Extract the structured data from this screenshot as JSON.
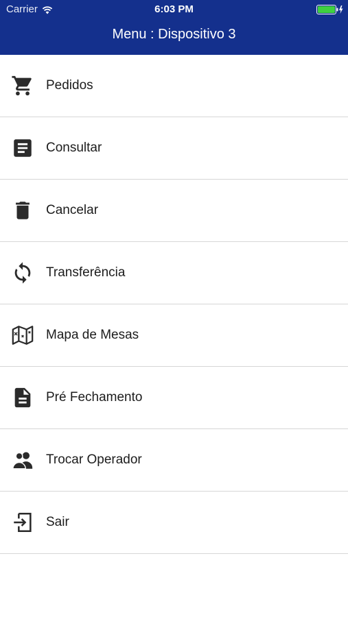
{
  "status_bar": {
    "carrier": "Carrier",
    "time": "6:03 PM",
    "wifi_icon": "wifi-icon",
    "battery_icon": "battery-icon",
    "battery_color": "#3fd13f"
  },
  "nav": {
    "title": "Menu : Dispositivo 3",
    "background_color": "#14308d"
  },
  "menu": {
    "items": [
      {
        "label": "Pedidos",
        "icon": "cart-icon"
      },
      {
        "label": "Consultar",
        "icon": "document-list-icon"
      },
      {
        "label": "Cancelar",
        "icon": "trash-icon"
      },
      {
        "label": "Transferência",
        "icon": "refresh-icon"
      },
      {
        "label": "Mapa de Mesas",
        "icon": "map-icon"
      },
      {
        "label": "Pré Fechamento",
        "icon": "file-text-icon"
      },
      {
        "label": "Trocar Operador",
        "icon": "users-icon"
      },
      {
        "label": "Sair",
        "icon": "exit-icon"
      }
    ]
  }
}
